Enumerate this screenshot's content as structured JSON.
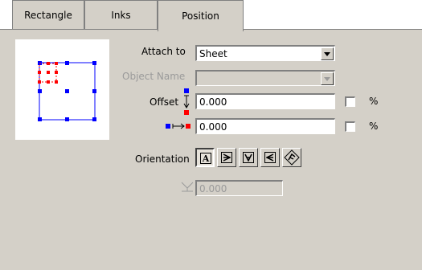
{
  "tabs": [
    {
      "label": "Rectangle",
      "active": false
    },
    {
      "label": "Inks",
      "active": false
    },
    {
      "label": "Position",
      "active": true
    }
  ],
  "attach_to": {
    "label": "Attach to",
    "value": "Sheet"
  },
  "object_name": {
    "label": "Object Name",
    "value": "",
    "enabled": false
  },
  "offset_vertical": {
    "label": "Offset",
    "value": "0.000",
    "percent_label": "%",
    "percent_checked": false
  },
  "offset_horizontal": {
    "value": "0.000",
    "percent_label": "%",
    "percent_checked": false
  },
  "orientation": {
    "label": "Orientation",
    "selected": "upright",
    "buttons": [
      "upright",
      "rotate-right",
      "upside-down",
      "rotate-left",
      "custom-angle"
    ]
  },
  "angle": {
    "value": "0.000",
    "enabled": false
  },
  "colors": {
    "handle_blue": "#0000ff",
    "handle_red": "#ff0000",
    "panel": "#d4d0c8"
  }
}
